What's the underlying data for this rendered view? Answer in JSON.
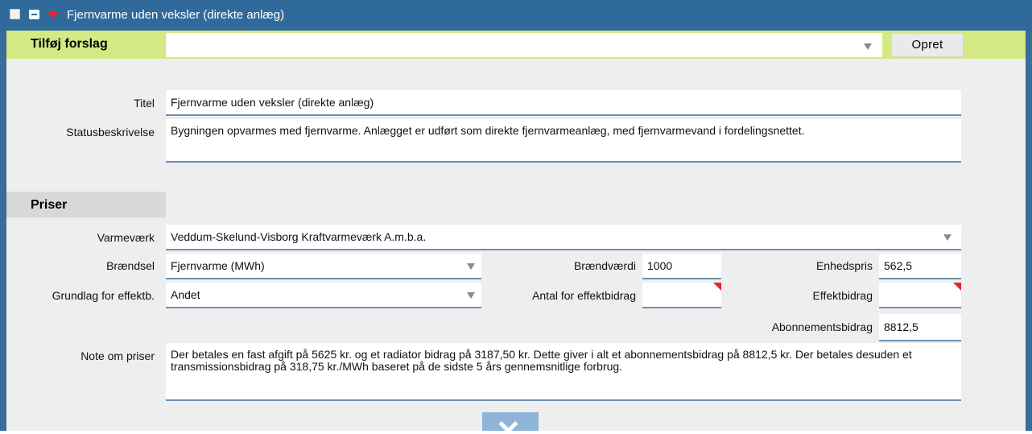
{
  "window": {
    "title": "Fjernvarme uden veksler (direkte anlæg)"
  },
  "suggestion_bar": {
    "label": "Tilføj forslag",
    "select_value": "",
    "button_label": "Opret"
  },
  "general": {
    "title_label": "Titel",
    "title_value": "Fjernvarme uden veksler (direkte anlæg)",
    "status_label": "Statusbeskrivelse",
    "status_value": "Bygningen opvarmes med fjernvarme. Anlægget er udført som direkte fjernvarmeanlæg, med fjernvarmevand i fordelingsnettet."
  },
  "prices": {
    "section_title": "Priser",
    "plant_label": "Varmeværk",
    "plant_value": "Veddum-Skelund-Visborg Kraftvarmeværk A.m.b.a.",
    "fuel_label": "Brændsel",
    "fuel_value": "Fjernvarme (MWh)",
    "calorific_label": "Brændværdi",
    "calorific_value": "1000",
    "unit_price_label": "Enhedspris",
    "unit_price_value": "562,5",
    "basis_label": "Grundlag for effektb.",
    "basis_value": "Andet",
    "count_label": "Antal for effektbidrag",
    "count_value": "",
    "effect_label": "Effektbidrag",
    "effect_value": "",
    "subscription_label": "Abonnementsbidrag",
    "subscription_value": "8812,5",
    "note_label": "Note om priser",
    "note_value": "Der betales en fast afgift på 5625 kr. og et radiator bidrag på 3187,50 kr. Dette giver i alt et abonnementsbidrag på 8812,5 kr. Der betales desuden et transmissionsbidrag på 318,75 kr./MWh baseret på de sidste 5 års gennemsnitlige forbrug."
  },
  "colors": {
    "titlebar": "#2f6a9b",
    "suggestion_bar": "#d4e883",
    "panel_bg": "#eeeeee",
    "field_underline": "#6d8fb3",
    "required_marker": "#e2262a"
  },
  "icons": {
    "collapse": "minus-icon",
    "menu": "red-triangle-down-icon",
    "expand": "chevron-down-icon"
  }
}
